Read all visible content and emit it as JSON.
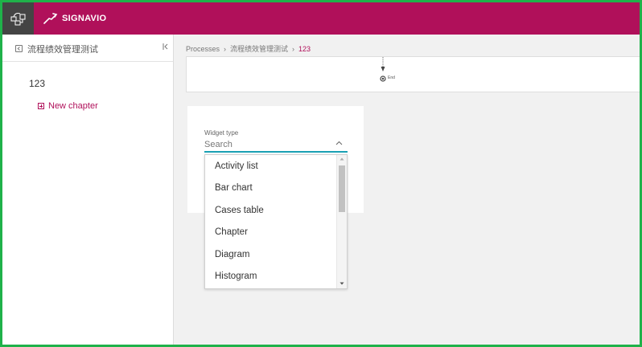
{
  "brand": {
    "name": "SIGNAVIO",
    "color": "#b0105a"
  },
  "sidebar": {
    "title": "流程绩效管理测试",
    "document_name": "123",
    "new_chapter_label": "New chapter"
  },
  "breadcrumb": {
    "items": [
      "Processes",
      "流程绩效管理测试",
      "123"
    ]
  },
  "diagram": {
    "end_label": "End"
  },
  "widget": {
    "type_label": "Widget type",
    "search_placeholder": "Search",
    "options": [
      "Activity list",
      "Bar chart",
      "Cases table",
      "Chapter",
      "Diagram",
      "Histogram"
    ]
  },
  "icons": {
    "app_switcher": "app-switcher-icon",
    "brand": "gazelle-logo-icon",
    "back": "back-icon",
    "collapse": "collapse-sidebar-icon",
    "plus": "plus-icon",
    "chevron_up": "chevron-up-icon"
  },
  "colors": {
    "accent": "#b0105a",
    "focus": "#1aa0b4",
    "frame": "#1fb24a"
  }
}
